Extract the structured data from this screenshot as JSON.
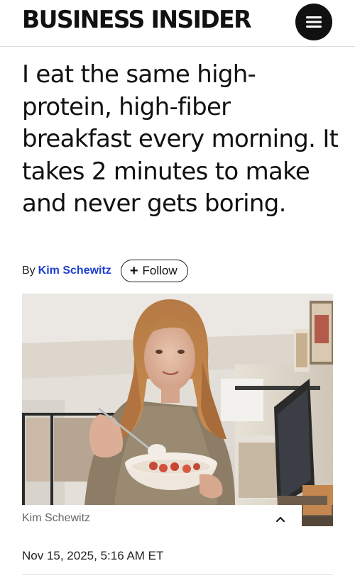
{
  "header": {
    "logo_text": "BUSINESS INSIDER",
    "menu_icon": "hamburger-menu-icon"
  },
  "article": {
    "headline": "I eat the same high-protein, high-fiber breakfast every morning. It takes 2 minutes to make and never gets boring.",
    "byline_prefix": "By",
    "author": "Kim Schewitz",
    "follow_label": "Follow",
    "follow_icon": "plus-icon",
    "image": {
      "caption": "Kim Schewitz",
      "toggle_icon": "chevron-up-icon"
    },
    "date": "Nov 15, 2025, 5:16 AM ET"
  },
  "colors": {
    "author_link": "#1f3fd1",
    "menu_button": "#111111",
    "divider": "#dcdcdc"
  }
}
